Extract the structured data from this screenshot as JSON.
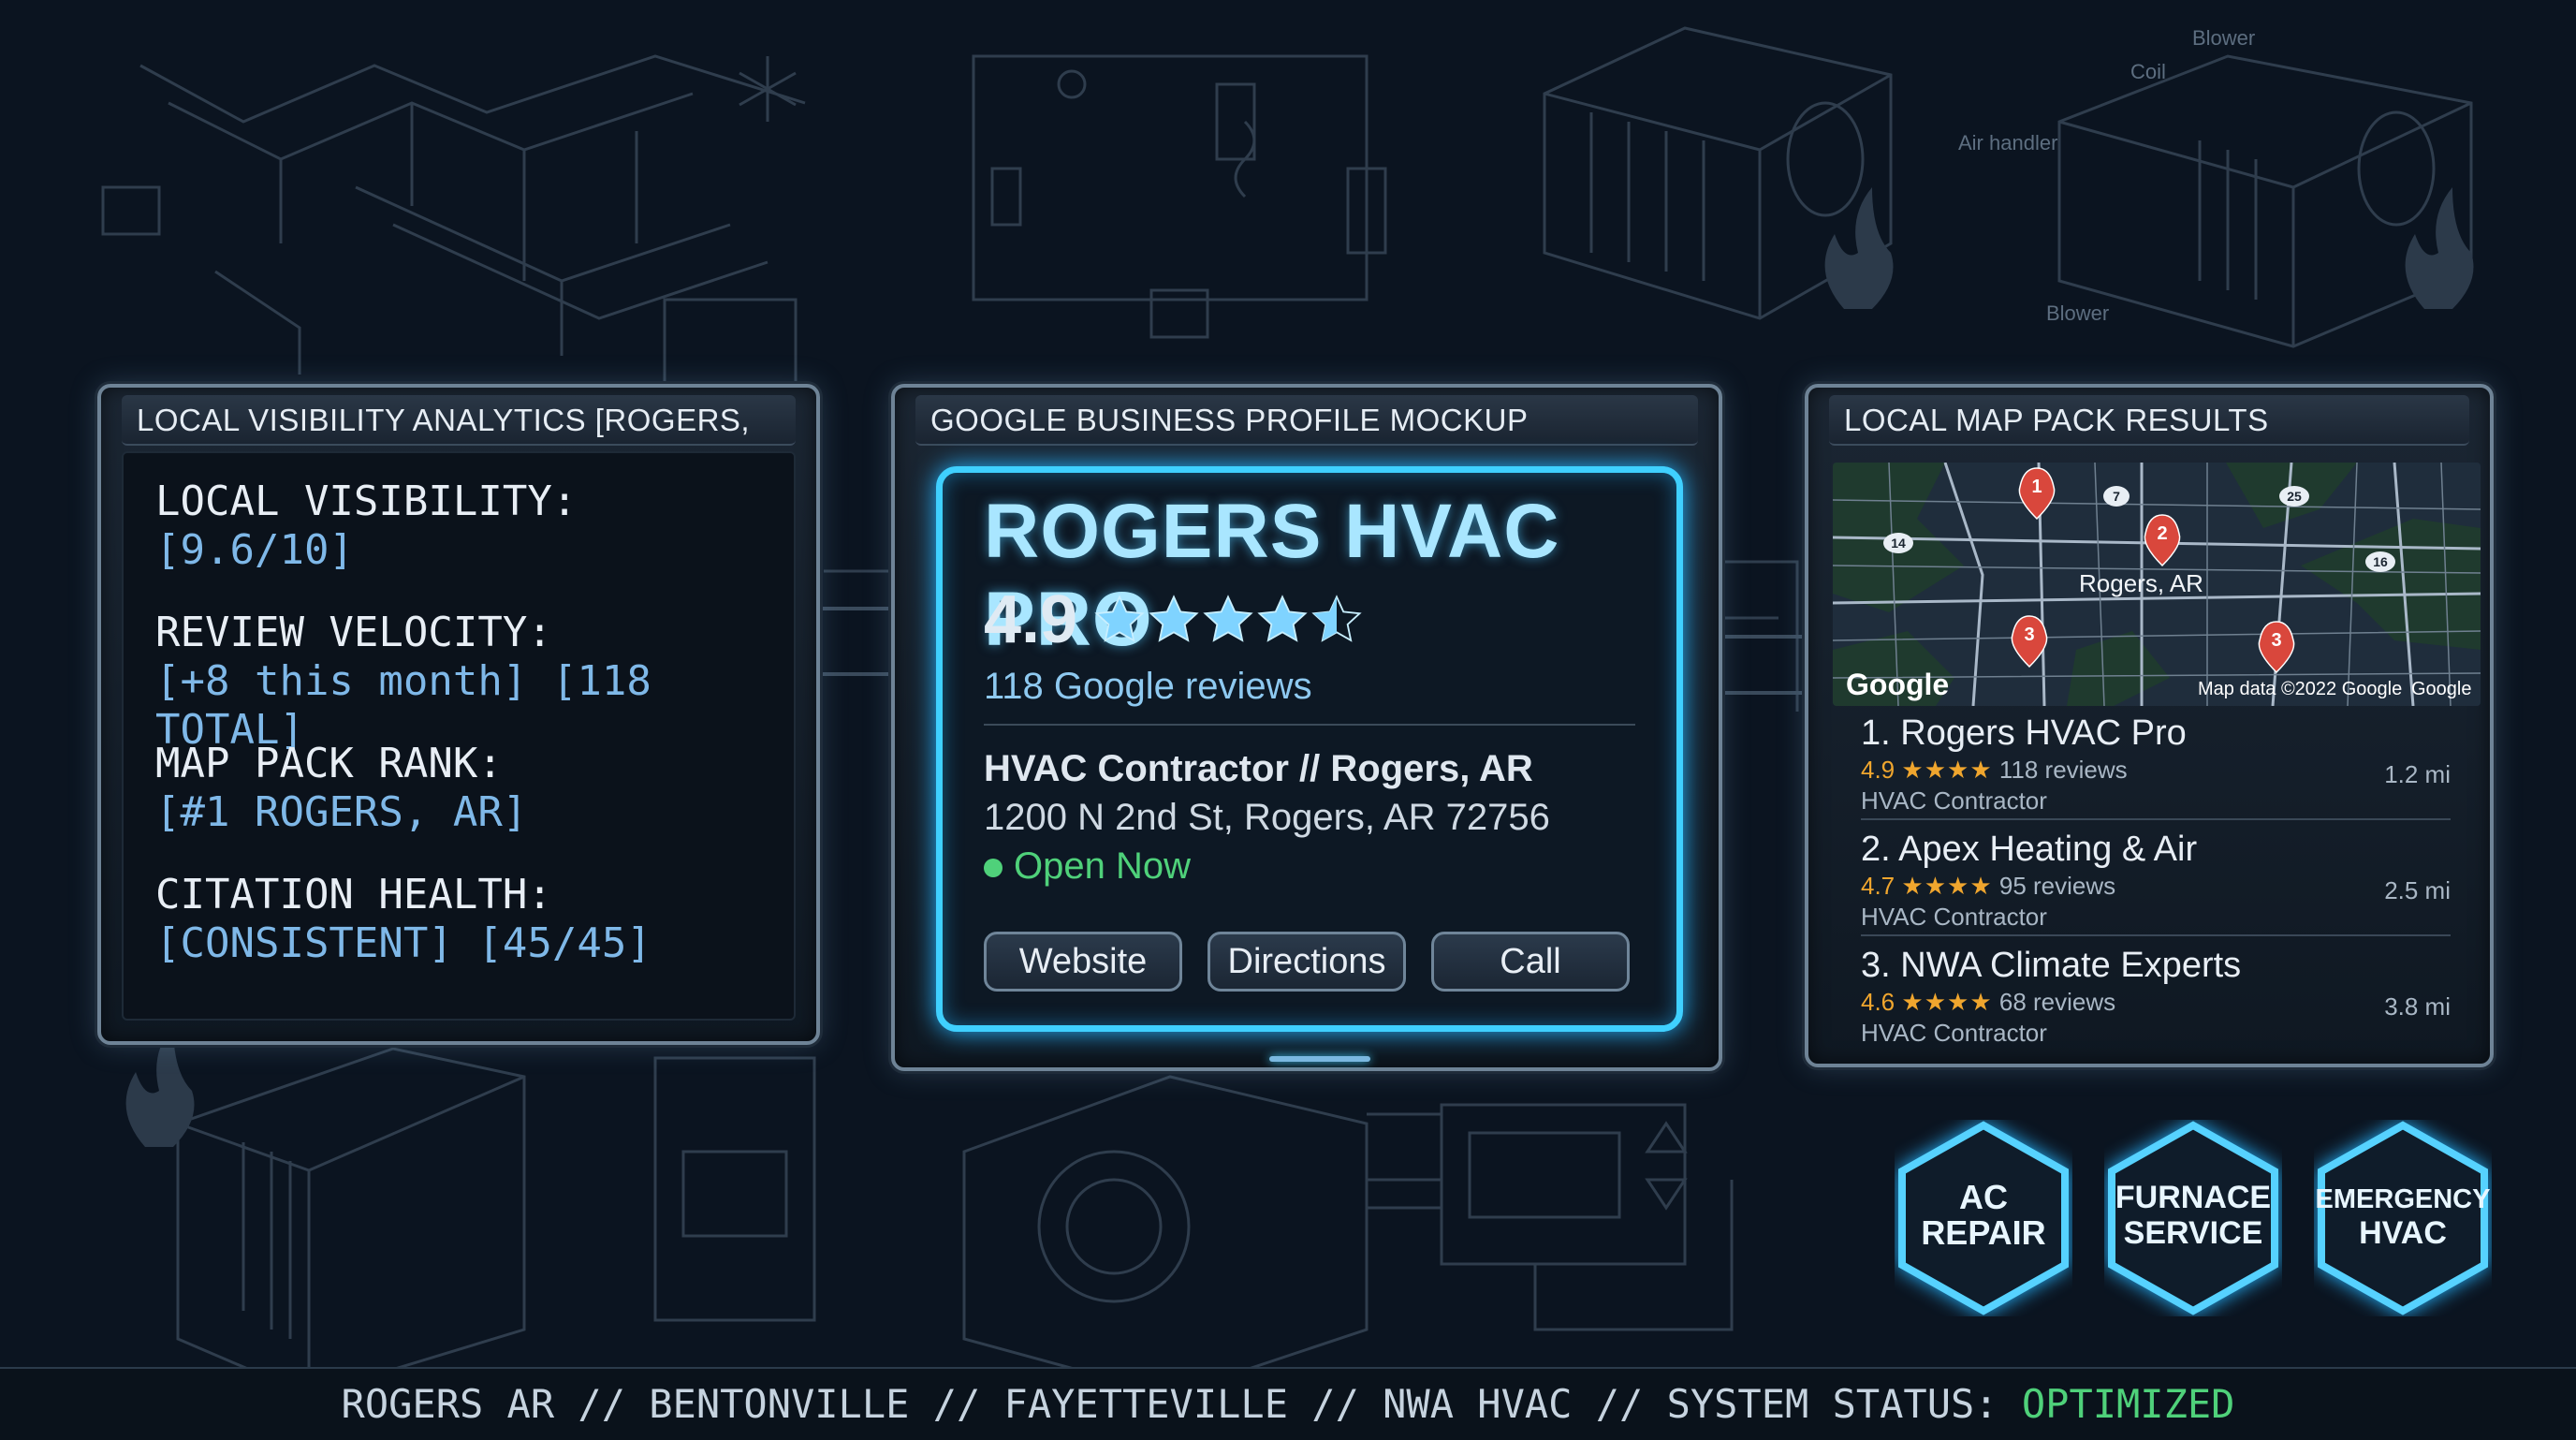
{
  "colors": {
    "background": "#0b1420",
    "accent": "#3fd0ff",
    "value_blue": "#7fb8e8",
    "open_green": "#4fd17a",
    "star_gold": "#f0a62e",
    "status_green": "#4fd17a"
  },
  "background_labels": {
    "blower_top": "Blower",
    "coil": "Coil",
    "air_handler": "Air handler",
    "blower_bottom": "Blower"
  },
  "analytics": {
    "header": "LOCAL VISIBILITY ANALYTICS [ROGERS, AR]",
    "metrics": [
      {
        "label": "LOCAL VISIBILITY:",
        "value": "[9.6/10]"
      },
      {
        "label": "REVIEW VELOCITY:",
        "value": "[+8 this month] [118 TOTAL]"
      },
      {
        "label": "MAP PACK RANK:",
        "value": "[#1 ROGERS, AR]"
      },
      {
        "label": "CITATION HEALTH:",
        "value": "[CONSISTENT] [45/45]"
      }
    ]
  },
  "gbp": {
    "header": "GOOGLE BUSINESS PROFILE MOCKUP",
    "business_name": "ROGERS HVAC PRO",
    "rating": "4.9",
    "stars": 4.5,
    "review_count": "118 Google reviews",
    "category": "HVAC Contractor // Rogers, AR",
    "address": "1200 N 2nd St, Rogers, AR 72756",
    "status": "Open Now",
    "buttons": [
      "Website",
      "Directions",
      "Call"
    ]
  },
  "map_pack": {
    "header": "LOCAL MAP PACK RESULTS",
    "map": {
      "city_label": "Rogers, AR",
      "google_logo": "Google",
      "attribution": "Map data ©2022 Google",
      "attribution_link": "Google",
      "route_shields": [
        "14",
        "7",
        "25",
        "16"
      ],
      "pins": [
        "1",
        "2",
        "3",
        "3"
      ]
    },
    "results": [
      {
        "rank": "1.",
        "name": "Rogers HVAC Pro",
        "rating": "4.9",
        "stars": "★★★★",
        "reviews": "118 reviews",
        "category": "HVAC Contractor",
        "distance": "1.2 mi"
      },
      {
        "rank": "2.",
        "name": "Apex Heating & Air",
        "rating": "4.7",
        "stars": "★★★★",
        "reviews": "95 reviews",
        "category": "HVAC Contractor",
        "distance": "2.5 mi"
      },
      {
        "rank": "3.",
        "name": "NWA Climate Experts",
        "rating": "4.6",
        "stars": "★★★★",
        "reviews": "68 reviews",
        "category": "HVAC Contractor",
        "distance": "3.8 mi"
      }
    ]
  },
  "services": [
    {
      "line1": "AC",
      "line2": "REPAIR"
    },
    {
      "line1": "FURNACE",
      "line2": "SERVICE"
    },
    {
      "line1": "EMERGENCY",
      "line2": "HVAC"
    }
  ],
  "footer": {
    "text": "ROGERS AR // BENTONVILLE // FAYETTEVILLE // NWA HVAC // SYSTEM STATUS: ",
    "status": "OPTIMIZED"
  }
}
